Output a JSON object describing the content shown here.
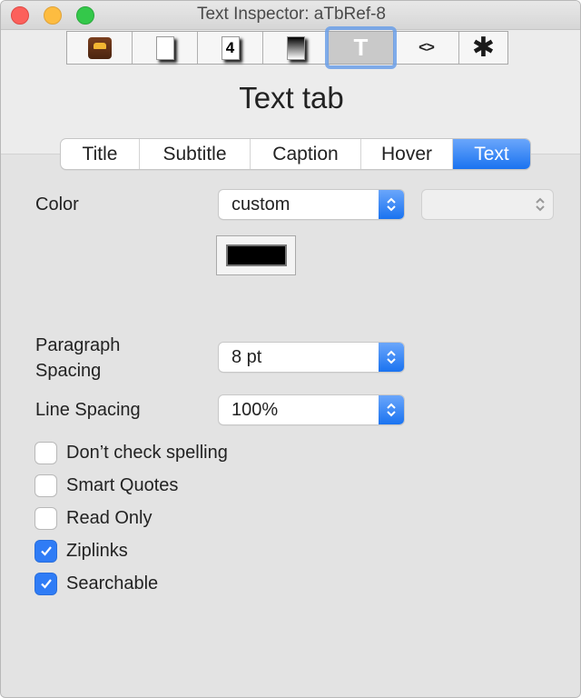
{
  "window": {
    "title": "Text Inspector: aTbRef-8"
  },
  "toolbar": {
    "buttons": [
      {
        "name": "properties-icon",
        "label": "",
        "active": false
      },
      {
        "name": "appearance-icon",
        "label": "",
        "active": false
      },
      {
        "name": "quickstamp-icon",
        "label": "4",
        "active": false
      },
      {
        "name": "background-icon",
        "label": "",
        "active": false
      },
      {
        "name": "text-icon",
        "label": "T",
        "active": true
      },
      {
        "name": "code-icon",
        "label": "<>",
        "active": false
      },
      {
        "name": "gear-icon",
        "label": "✱",
        "active": false
      }
    ]
  },
  "page": {
    "title": "Text tab"
  },
  "tabs": [
    {
      "label": "Title",
      "selected": false
    },
    {
      "label": "Subtitle",
      "selected": false
    },
    {
      "label": "Caption",
      "selected": false
    },
    {
      "label": "Hover",
      "selected": false
    },
    {
      "label": "Text",
      "selected": true
    }
  ],
  "color": {
    "label": "Color",
    "selected": "custom",
    "secondary_value": "",
    "swatch_color": "#000000"
  },
  "paragraph_spacing": {
    "label_line1": "Paragraph",
    "label_line2": "Spacing",
    "value": "8 pt"
  },
  "line_spacing": {
    "label": "Line Spacing",
    "value": "100%"
  },
  "checkboxes": [
    {
      "label": "Don’t check spelling",
      "checked": false
    },
    {
      "label": "Smart Quotes",
      "checked": false
    },
    {
      "label": "Read Only",
      "checked": false
    },
    {
      "label": "Ziplinks",
      "checked": true
    },
    {
      "label": "Searchable",
      "checked": true
    }
  ],
  "colors": {
    "accent": "#1a73f0",
    "background": "#e3e3e3"
  }
}
